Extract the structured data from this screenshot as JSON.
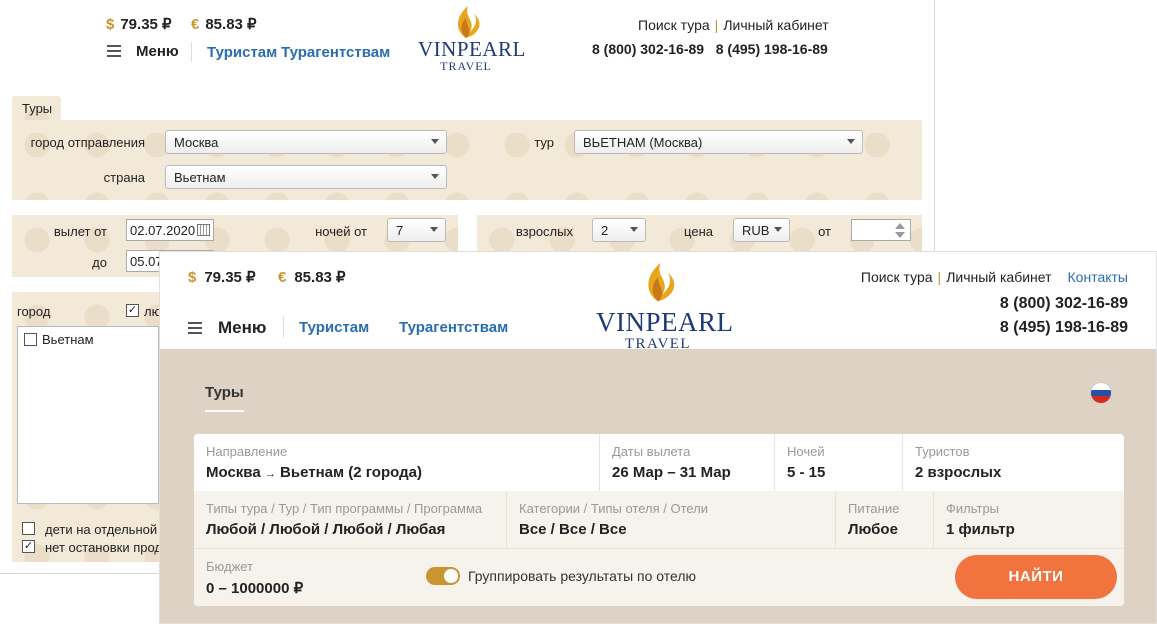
{
  "old_site": {
    "currency": {
      "usd_symbol": "$",
      "usd": "79.35 ₽",
      "eur_symbol": "€",
      "eur": "85.83 ₽"
    },
    "menu_label": "Меню",
    "nav": {
      "tourists": "Туристам",
      "agencies": "Турагентствам"
    },
    "logo": {
      "line1": "VINPEARL",
      "line2": "TRAVEL"
    },
    "top_links": {
      "search": "Поиск тура",
      "sep": "|",
      "cabinet": "Личный кабинет"
    },
    "phones": "8 (800) 302-16-89   8 (495) 198-16-89",
    "tab": "Туры",
    "form": {
      "departure_city_label": "город отправления",
      "departure_city": "Москва",
      "tour_label": "тур",
      "tour": "ВЬЕТНАМ (Москва)",
      "country_label": "страна",
      "country": "Вьетнам",
      "depart_from_label": "вылет от",
      "depart_from": "02.07.2020",
      "depart_to_label": "до",
      "depart_to": "05.07",
      "nights_label": "ночей от",
      "nights": "7",
      "adults_label": "взрослых",
      "adults": "2",
      "price_label": "цена",
      "currency": "RUB",
      "from_label": "от",
      "city_label": "город",
      "any_label": "лю",
      "city_option": "Вьетнам",
      "kids_label": "дети на отдельной",
      "nonstop_label": "нет остановки прод"
    }
  },
  "new_site": {
    "currency": {
      "usd_symbol": "$",
      "usd": "79.35 ₽",
      "eur_symbol": "€",
      "eur": "85.83 ₽"
    },
    "menu_label": "Меню",
    "nav": {
      "tourists": "Туристам",
      "agencies": "Турагентствам"
    },
    "logo": {
      "line1": "VINPEARL",
      "line2": "TRAVEL"
    },
    "top_links": {
      "search": "Поиск тура",
      "sep": "|",
      "cabinet": "Личный кабинет",
      "contacts": "Контакты"
    },
    "phones": [
      "8 (800) 302-16-89",
      "8 (495) 198-16-89"
    ],
    "tab": "Туры",
    "search": {
      "direction": {
        "caption": "Направление",
        "from": "Москва",
        "arrow": "→",
        "to": "Вьетнам (2 города)"
      },
      "dates": {
        "caption": "Даты вылета",
        "value": "26 Мар – 31 Мар"
      },
      "nights": {
        "caption": "Ночей",
        "value": "5 - 15"
      },
      "tourists": {
        "caption": "Туристов",
        "value": "2 взрослых"
      },
      "tour_types": {
        "caption": "Типы тура / Тур / Тип программы / Программа",
        "value": "Любой / Любой / Любой / Любая"
      },
      "categories": {
        "caption": "Категории / Типы отеля / Отели",
        "value": "Все / Все / Все"
      },
      "meals": {
        "caption": "Питание",
        "value": "Любое"
      },
      "filters": {
        "caption": "Фильтры",
        "value": "1 фильтр"
      },
      "budget": {
        "caption": "Бюджет",
        "value": "0 – 1000000 ₽"
      },
      "group_toggle": {
        "label": "Группировать результаты по отелю",
        "on": true
      },
      "find_button": "НАЙТИ"
    },
    "colors": {
      "accent": "#f1733d",
      "gold": "#c99531",
      "link": "#2a6db0",
      "panel": "#ddd2c3"
    }
  }
}
